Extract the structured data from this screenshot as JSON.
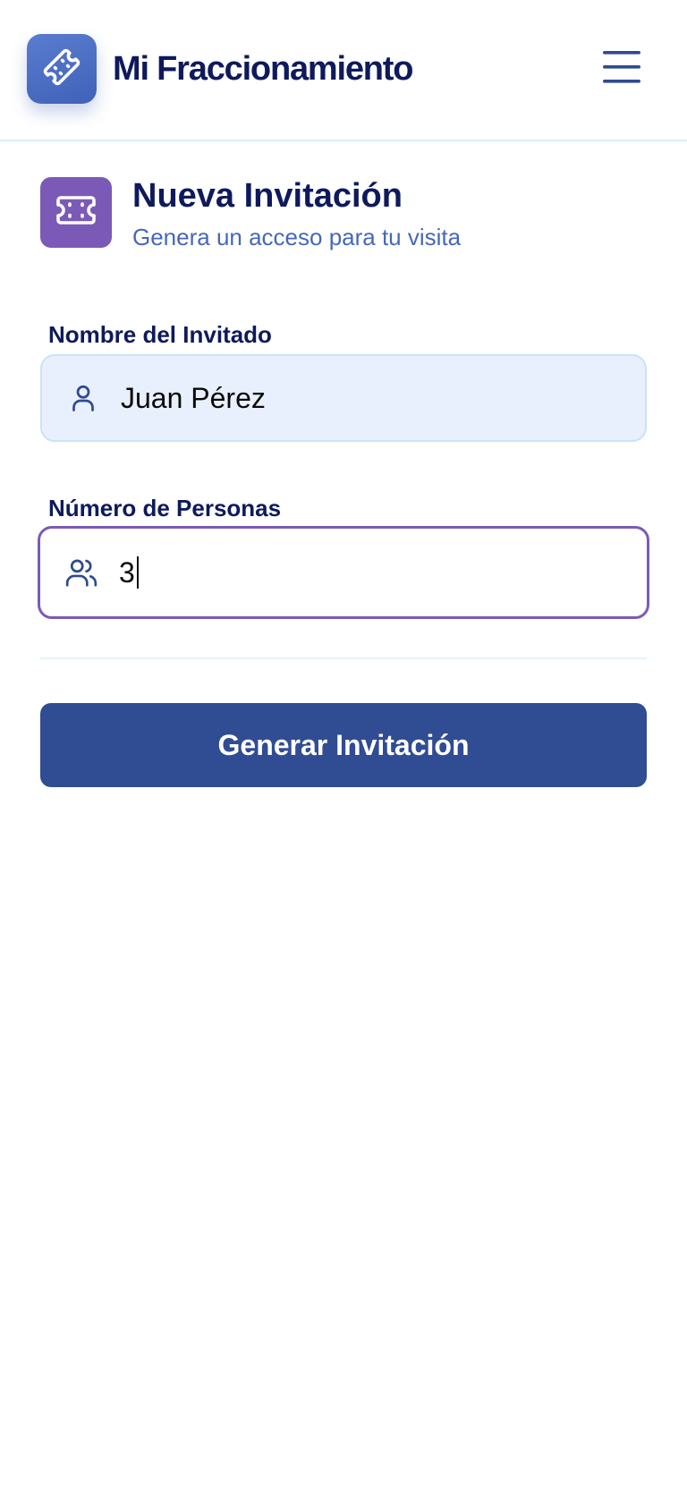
{
  "header": {
    "app_title": "Mi Fraccionamiento",
    "logo_icon": "ticket-icon",
    "menu_icon": "hamburger-menu-icon"
  },
  "section": {
    "icon": "ticket-icon",
    "title": "Nueva Invitación",
    "subtitle": "Genera un acceso para tu visita"
  },
  "form": {
    "guest_name": {
      "label": "Nombre del Invitado",
      "icon": "user-icon",
      "value": "Juan Pérez"
    },
    "people_count": {
      "label": "Número de Personas",
      "icon": "users-icon",
      "value": "3"
    },
    "submit_label": "Generar Invitación"
  },
  "colors": {
    "primary": "#304c92",
    "accent": "#7b5ab7",
    "heading": "#0e1a5c",
    "subtitle": "#4668b8",
    "input_fill": "#e8f0fd"
  }
}
